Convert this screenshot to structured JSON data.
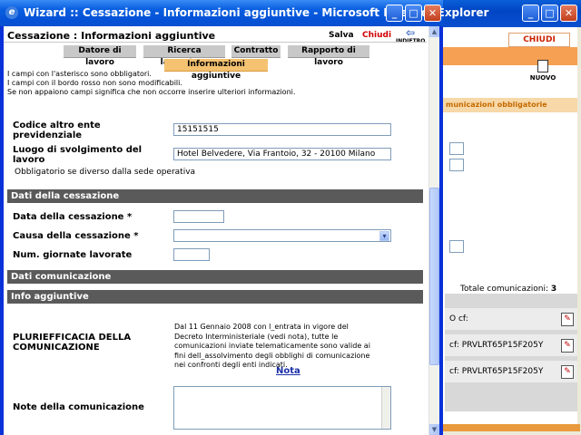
{
  "background_window": {
    "chiudi": "CHIUDI",
    "nuovo": "NUOVO",
    "tab": "municazioni obbligatorie",
    "totale_label": "Totale comunicazioni:",
    "totale_value": "3",
    "rows": [
      "O cf:",
      "cf: PRVLRT65P15F205Y",
      "cf: PRVLRT65P15F205Y"
    ]
  },
  "window": {
    "title": "Wizard :: Cessazione - Informazioni aggiuntive - Microsoft Internet Explorer",
    "icon": "ie-icon",
    "controls": {
      "minimize": "_",
      "maximize": "□",
      "close": "✕"
    }
  },
  "header": {
    "title": "Cessazione : Informazioni aggiuntive",
    "salva": "Salva",
    "chiudi": "Chiudi",
    "indietro": "INDIETRO"
  },
  "tabs": [
    {
      "label": "Datore di lavoro",
      "active": false
    },
    {
      "label": "Ricerca lavoratore",
      "active": false
    },
    {
      "label": "Contratto",
      "active": false
    },
    {
      "label": "Rapporto di lavoro",
      "active": false
    },
    {
      "label": "Informazioni aggiuntive",
      "active": true
    }
  ],
  "info_lines": [
    "I campi con l'asterisco sono obbligatori.",
    "I campi con il bordo rosso non sono modificabili.",
    "Se non appaiono campi significa che non occorre inserire ulteriori informazioni."
  ],
  "form": {
    "codice_altro_ente": {
      "label": "Codice altro ente previdenziale",
      "value": "15151515"
    },
    "luogo": {
      "label": "Luogo di svolgimento del lavoro",
      "value": "Hotel Belvedere, Via Frantoio, 32 - 20100 Milano"
    },
    "luogo_note": "Obbligatorio se diverso dalla sede operativa"
  },
  "sections": {
    "cessazione": "Dati della cessazione",
    "comunicazione": "Dati comunicazione",
    "info": "Info aggiuntive"
  },
  "cessazione": {
    "data_label": "Data della cessazione *",
    "data_value": "",
    "causa_label": "Causa della cessazione *",
    "causa_value": "",
    "giornate_label": "Num. giornate lavorate",
    "giornate_value": ""
  },
  "info_aggiuntive": {
    "plurie_label": "PLURIEFFICACIA DELLA COMUNICAZIONE",
    "plurie_text": "Dal 11 Gennaio 2008 con l_entrata in vigore del Decreto Interministeriale (vedi nota), tutte le comunicazioni inviate telematicamente sono valide ai fini dell_assolvimento degli obblighi di comunicazione nei confronti degli enti indicati.",
    "nota_link": "Nota",
    "note_label": "Note della comunicazione",
    "note_value": ""
  },
  "colors": {
    "titlebar": "#0a5fe0",
    "section_bg": "#5a5a5a",
    "active_tab": "#f5c271",
    "chiudi": "#d00000",
    "accent_orange": "#e89a3c"
  }
}
